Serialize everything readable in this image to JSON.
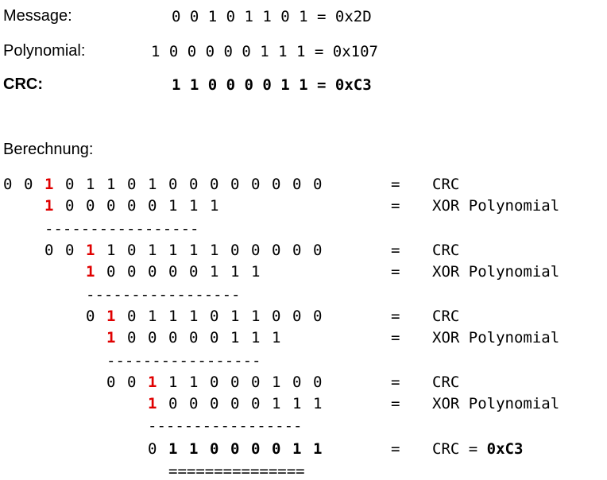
{
  "header": {
    "message_label": "Message:",
    "message_value": "0 0 1 0 1 1 0 1 = 0x2D",
    "polynomial_label": "Polynomial:",
    "polynomial_value": "1 0 0 0 0 0 1 1 1 = 0x107",
    "crc_label": "CRC:",
    "crc_value": "1 1 0 0 0 0 1 1 = 0xC3"
  },
  "calc_label": "Berechnung:",
  "equals_sign": "=",
  "rows": [
    {
      "offset": 0,
      "bits": [
        "0",
        "0",
        "1",
        "0",
        "1",
        "1",
        "0",
        "1",
        "0",
        "0",
        "0",
        "0",
        "0",
        "0",
        "0",
        "0"
      ],
      "red_index": 2,
      "bold": false,
      "desc": "CRC"
    },
    {
      "offset": 2,
      "bits": [
        "1",
        "0",
        "0",
        "0",
        "0",
        "0",
        "1",
        "1",
        "1"
      ],
      "red_index": 0,
      "bold": false,
      "desc": "XOR Polynomial"
    },
    {
      "offset": 2,
      "rule": "-----------------"
    },
    {
      "offset": 2,
      "bits": [
        "0",
        "0",
        "1",
        "1",
        "0",
        "1",
        "1",
        "1",
        "1",
        "0",
        "0",
        "0",
        "0",
        "0"
      ],
      "red_index": 2,
      "bold": false,
      "desc": "CRC"
    },
    {
      "offset": 4,
      "bits": [
        "1",
        "0",
        "0",
        "0",
        "0",
        "0",
        "1",
        "1",
        "1"
      ],
      "red_index": 0,
      "bold": false,
      "desc": "XOR Polynomial"
    },
    {
      "offset": 4,
      "rule": "-----------------"
    },
    {
      "offset": 4,
      "bits": [
        "0",
        "1",
        "0",
        "1",
        "1",
        "1",
        "0",
        "1",
        "1",
        "0",
        "0",
        "0"
      ],
      "red_index": 1,
      "bold": false,
      "desc": "CRC"
    },
    {
      "offset": 5,
      "bits": [
        "1",
        "0",
        "0",
        "0",
        "0",
        "0",
        "1",
        "1",
        "1"
      ],
      "red_index": 0,
      "bold": false,
      "desc": "XOR Polynomial"
    },
    {
      "offset": 5,
      "rule": "-----------------"
    },
    {
      "offset": 5,
      "bits": [
        "0",
        "0",
        "1",
        "1",
        "1",
        "0",
        "0",
        "0",
        "1",
        "0",
        "0"
      ],
      "red_index": 2,
      "bold": false,
      "desc": "CRC"
    },
    {
      "offset": 7,
      "bits": [
        "1",
        "0",
        "0",
        "0",
        "0",
        "0",
        "1",
        "1",
        "1"
      ],
      "red_index": 0,
      "bold": false,
      "desc": "XOR Polynomial"
    },
    {
      "offset": 7,
      "rule": "-----------------"
    },
    {
      "offset": 7,
      "bits": [
        "0",
        "1",
        "1",
        "0",
        "0",
        "0",
        "0",
        "1",
        "1"
      ],
      "red_index": -1,
      "bold": true,
      "desc_prefix": "CRC = ",
      "desc_bold": "0xC3"
    },
    {
      "offset": 8,
      "rule": "==============="
    }
  ],
  "colors": {
    "highlight": "#e00000",
    "text": "#000000",
    "background": "#ffffff"
  }
}
